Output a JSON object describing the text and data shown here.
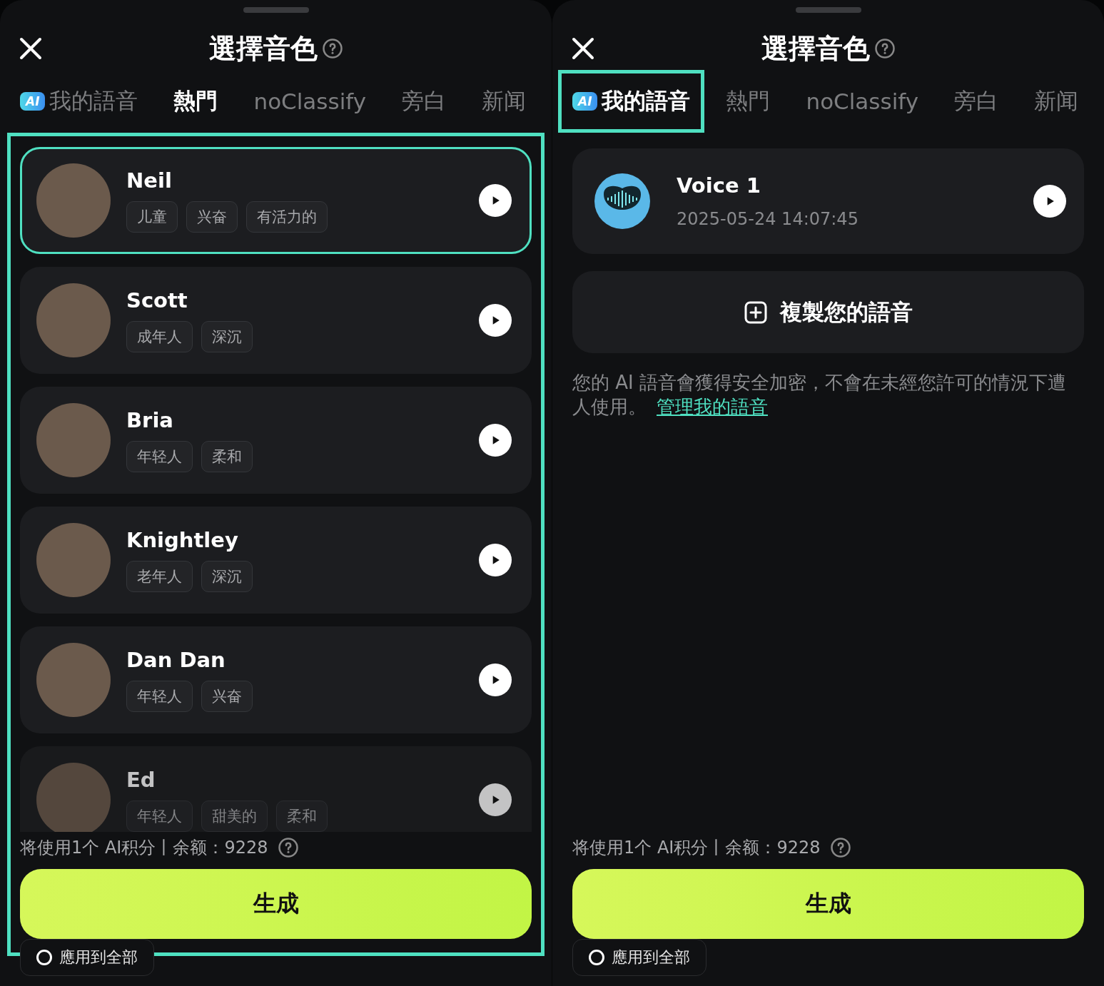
{
  "panels": [
    {
      "title": "選擇音色",
      "tabs": [
        {
          "label": "我的語音",
          "badge": "AI",
          "selected": false,
          "outlined": false
        },
        {
          "label": "熱門",
          "selected": true,
          "outlined": false
        },
        {
          "label": "noClassify",
          "selected": false,
          "outlined": false
        },
        {
          "label": "旁白",
          "selected": false,
          "outlined": false
        },
        {
          "label": "新闻",
          "selected": false,
          "outlined": false
        }
      ],
      "content": {
        "kind": "voice_list",
        "outlined": true,
        "voices": [
          {
            "name": "Neil",
            "tags": [
              "儿童",
              "兴奋",
              "有活力的"
            ],
            "selected": true
          },
          {
            "name": "Scott",
            "tags": [
              "成年人",
              "深沉"
            ],
            "selected": false
          },
          {
            "name": "Bria",
            "tags": [
              "年轻人",
              "柔和"
            ],
            "selected": false
          },
          {
            "name": "Knightley",
            "tags": [
              "老年人",
              "深沉"
            ],
            "selected": false
          },
          {
            "name": "Dan Dan",
            "tags": [
              "年轻人",
              "兴奋"
            ],
            "selected": false
          },
          {
            "name": "Ed",
            "tags": [
              "年轻人",
              "甜美的",
              "柔和"
            ],
            "selected": false
          }
        ]
      },
      "credits": "将使用1个 AI积分丨余额：9228",
      "generate": "生成",
      "apply_all": {
        "label": "應用到全部",
        "checked": false
      }
    },
    {
      "title": "選擇音色",
      "tabs": [
        {
          "label": "我的語音",
          "badge": "AI",
          "selected": true,
          "outlined": true
        },
        {
          "label": "熱門",
          "selected": false,
          "outlined": false
        },
        {
          "label": "noClassify",
          "selected": false,
          "outlined": false
        },
        {
          "label": "旁白",
          "selected": false,
          "outlined": false
        },
        {
          "label": "新闻",
          "selected": false,
          "outlined": false
        }
      ],
      "content": {
        "kind": "my_voices",
        "outlined": false,
        "voice": {
          "name": "Voice 1",
          "date": "2025-05-24 14:07:45"
        },
        "clone_button": "複製您的語音",
        "notice": "您的 AI 語音會獲得安全加密，不會在未經您許可的情況下遭人使用。",
        "notice_link": "管理我的語音"
      },
      "credits": "将使用1个 AI积分丨余额：9228",
      "generate": "生成",
      "apply_all": {
        "label": "應用到全部",
        "checked": false
      }
    }
  ]
}
